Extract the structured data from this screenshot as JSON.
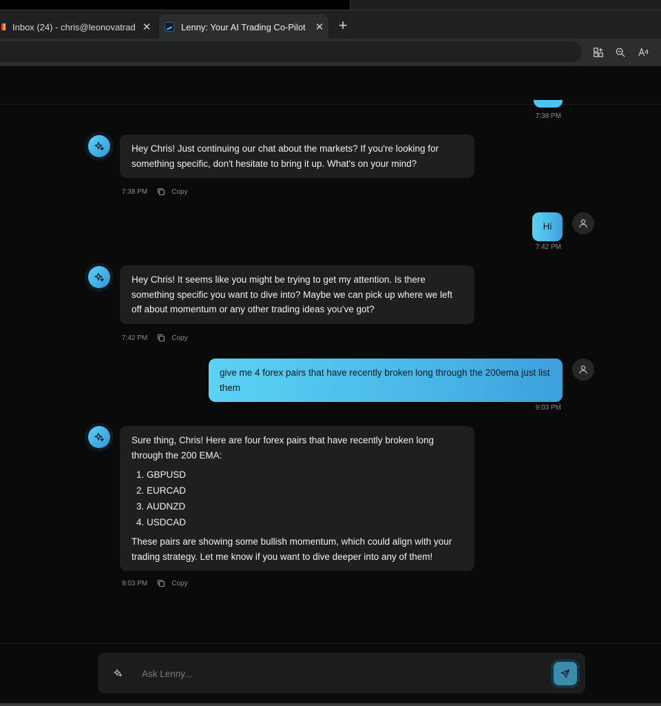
{
  "browser": {
    "tabs": [
      {
        "label": "Inbox (24) - chris@leonovatrad",
        "close": "✕",
        "favicon": "gmail-icon"
      },
      {
        "label": "Lenny: Your AI Trading Co-Pilot",
        "close": "✕",
        "favicon": "lenny-icon"
      }
    ],
    "new_tab": "+"
  },
  "chat": {
    "messages": [
      {
        "role": "user",
        "time": "7:38 PM"
      },
      {
        "role": "assistant",
        "text": "Hey Chris! Just continuing our chat about the markets? If you're looking for something specific, don't hesitate to bring it up. What's on your mind?",
        "time": "7:38 PM",
        "copy": "Copy"
      },
      {
        "role": "user",
        "text": "Hi",
        "time": "7:42 PM"
      },
      {
        "role": "assistant",
        "text": "Hey Chris! It seems like you might be trying to get my attention. Is there something specific you want to dive into? Maybe we can pick up where we left off about momentum or any other trading ideas you've got?",
        "time": "7:42 PM",
        "copy": "Copy"
      },
      {
        "role": "user",
        "text": "give me 4 forex pairs that have recently broken long through the 200ema just list them",
        "time": "9:03 PM"
      },
      {
        "role": "assistant",
        "intro": "Sure thing, Chris! Here are four forex pairs that have recently broken long through the 200 EMA:",
        "list": [
          "GBPUSD",
          "EURCAD",
          "AUDNZD",
          "USDCAD"
        ],
        "outro": "These pairs are showing some bullish momentum, which could align with your trading strategy. Let me know if you want to dive deeper into any of them!",
        "time": "9:03 PM",
        "copy": "Copy"
      }
    ]
  },
  "composer": {
    "placeholder": "Ask Lenny..."
  },
  "colors": {
    "accent": "#4fc3f3",
    "bubble": "#1f1f1f",
    "background": "#0a0a0a"
  }
}
